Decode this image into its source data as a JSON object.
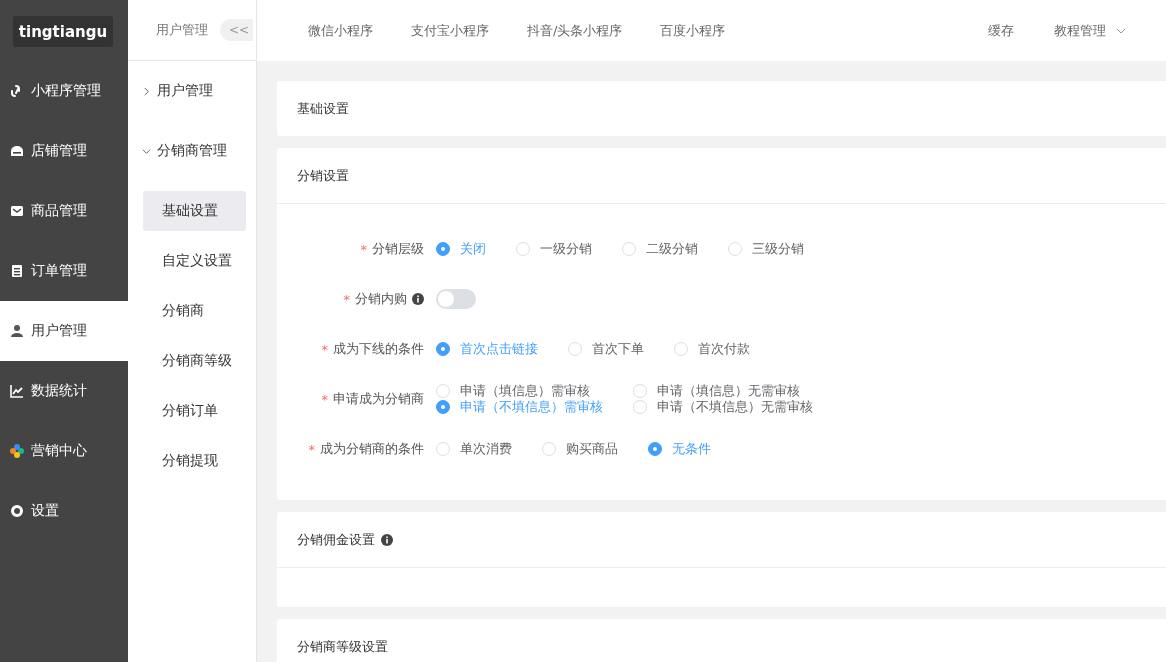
{
  "logo": "tingtiangu",
  "sidebar": {
    "items": [
      {
        "label": "小程序管理",
        "selected": false
      },
      {
        "label": "店铺管理",
        "selected": false
      },
      {
        "label": "商品管理",
        "selected": false
      },
      {
        "label": "订单管理",
        "selected": false
      },
      {
        "label": "用户管理",
        "selected": true
      },
      {
        "label": "数据统计",
        "selected": false
      },
      {
        "label": "营销中心",
        "selected": false
      },
      {
        "label": "设置",
        "selected": false
      }
    ]
  },
  "subnav": {
    "title": "用户管理",
    "collapse_button": "<<",
    "items": [
      {
        "label": "用户管理",
        "expanded": false
      },
      {
        "label": "分销商管理",
        "expanded": true,
        "children": [
          {
            "label": "基础设置",
            "selected": true
          },
          {
            "label": "自定义设置",
            "selected": false
          },
          {
            "label": "分销商",
            "selected": false
          },
          {
            "label": "分销商等级",
            "selected": false
          },
          {
            "label": "分销订单",
            "selected": false
          },
          {
            "label": "分销提现",
            "selected": false
          }
        ]
      }
    ]
  },
  "topbar": {
    "tabs": [
      {
        "label": "微信小程序",
        "selected": false
      },
      {
        "label": "支付宝小程序",
        "selected": false
      },
      {
        "label": "抖音/头条小程序",
        "selected": false
      },
      {
        "label": "百度小程序",
        "selected": false
      }
    ],
    "actions": [
      {
        "label": "缓存",
        "kind": "link"
      },
      {
        "label": "教程管理",
        "kind": "dropdown"
      }
    ]
  },
  "cards": [
    {
      "title": "基础设置"
    },
    {
      "title": "分销设置",
      "rows": [
        {
          "label": "分销层级",
          "kind": "radio",
          "required_mark": "*",
          "options": [
            {
              "label": "关闭",
              "selected": true
            },
            {
              "label": "一级分销",
              "selected": false
            },
            {
              "label": "二级分销",
              "selected": false
            },
            {
              "label": "三级分销",
              "selected": false
            }
          ]
        },
        {
          "label": "分销内购",
          "kind": "switch",
          "required_mark": "*",
          "info": true,
          "on": false
        },
        {
          "label": "成为下线的条件",
          "kind": "radio",
          "required_mark": "*",
          "options": [
            {
              "label": "首次点击链接",
              "selected": true
            },
            {
              "label": "首次下单",
              "selected": false
            },
            {
              "label": "首次付款",
              "selected": false
            }
          ]
        },
        {
          "label": "申请成为分销商",
          "kind": "radio-grid",
          "required_mark": "*",
          "options": [
            {
              "label": "申请（填信息）需审核",
              "selected": false
            },
            {
              "label": "申请（填信息）无需审核",
              "selected": false
            },
            {
              "label": "申请（不填信息）需审核",
              "selected": true
            },
            {
              "label": "申请（不填信息）无需审核",
              "selected": false
            }
          ]
        },
        {
          "label": "成为分销商的条件",
          "kind": "radio",
          "required_mark": "*",
          "options": [
            {
              "label": "单次消费",
              "selected": false
            },
            {
              "label": "购买商品",
              "selected": false
            },
            {
              "label": "无条件",
              "selected": true
            }
          ]
        }
      ]
    },
    {
      "title": "分销佣金设置",
      "info": true,
      "empty_body": true
    },
    {
      "title": "分销商等级设置"
    }
  ]
}
